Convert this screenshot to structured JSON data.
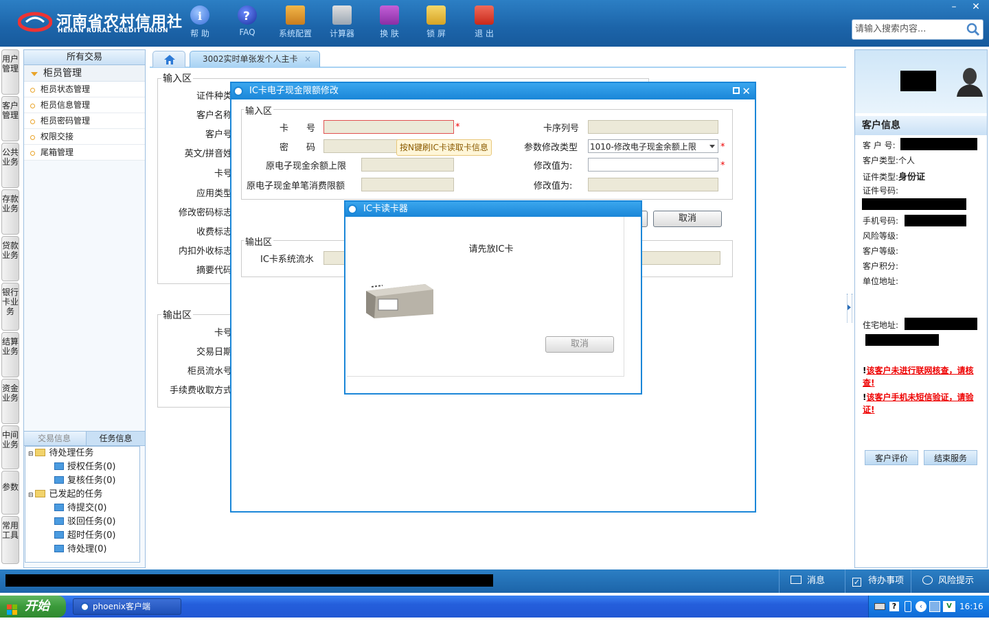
{
  "header": {
    "logo_cn": "河南省农村信用社",
    "logo_en": "HENAN RURAL CREDIT UNION",
    "toolbar": [
      {
        "label": "帮 助",
        "icon": "info-icon"
      },
      {
        "label": "FAQ",
        "icon": "question-icon"
      },
      {
        "label": "系统配置",
        "icon": "toolbox-icon"
      },
      {
        "label": "计算器",
        "icon": "calculator-icon"
      },
      {
        "label": "换 肤",
        "icon": "shirt-icon"
      },
      {
        "label": "锁 屏",
        "icon": "lock-icon"
      },
      {
        "label": "退 出",
        "icon": "power-icon"
      }
    ],
    "search_placeholder": "请输入搜索内容...",
    "minimize": "–",
    "close": "✕"
  },
  "vtabs": [
    "用户管理",
    "客户管理",
    "公共业务",
    "存款业务",
    "贷款业务",
    "银行卡业务",
    "结算业务",
    "资金业务",
    "中间业务",
    "参数",
    "常用工具"
  ],
  "leftpanel": {
    "title": "所有交易",
    "group": "柜员管理",
    "items": [
      "柜员状态管理",
      "柜员信息管理",
      "柜员密码管理",
      "权限交接",
      "尾箱管理"
    ],
    "tabs": [
      "交易信息",
      "任务信息"
    ],
    "tree": {
      "pending": "待处理任务",
      "auth": "授权任务(0)",
      "review": "复核任务(0)",
      "initiated": "已发起的任务",
      "to_submit": "待提交(0)",
      "rejected": "驳回任务(0)",
      "timeout": "超时任务(0)",
      "to_process": "待处理(0)"
    }
  },
  "content": {
    "tab_label": "3002实时单张发个人主卡",
    "tab_close": "×",
    "input_section": "输入区",
    "input_labels": [
      "证件种类",
      "客户名称",
      "客户号",
      "英文/拼音姓",
      "卡号",
      "应用类型",
      "修改密码标志",
      "收费标志",
      "内扣外收标志",
      "摘要代码"
    ],
    "output_section": "输出区",
    "output_labels": [
      "卡号",
      "交易日期",
      "柜员流水号",
      "手续费收取方式"
    ]
  },
  "dialog": {
    "title": "IC卡电子现金限额修改",
    "input_section": "输入区",
    "card_no_label": "卡　　号",
    "password_label": "密　　码",
    "tooltip": "按N键刷IC卡读取卡信息",
    "balance_limit_label": "原电子现金余额上限",
    "single_limit_label": "原电子现金单笔消费限额",
    "card_seq_label": "卡序列号",
    "param_type_label": "参数修改类型",
    "param_type_value": "1010-修改电子现金余额上限",
    "modify_value_label_1": "修改值为:",
    "modify_value_label_2": "修改值为:",
    "required": "*",
    "output_section": "输出区",
    "ic_serial_label": "IC卡系统流水",
    "cancel_button": "取消"
  },
  "reader": {
    "title": "IC卡读卡器",
    "message": "请先放IC卡",
    "cancel_button": "取消"
  },
  "right": {
    "title": "客户信息",
    "fields": [
      "客 户 号:",
      "客户类型:",
      "证件类型:",
      "证件号码:",
      "手机号码:",
      "风险等级:",
      "客户等级:",
      "客户积分:",
      "单位地址:",
      "住宅地址:"
    ],
    "customer_type": "个人",
    "id_type": "身份证",
    "warn1": "该客户未进行联网核查，请核查!",
    "warn2": "该客户手机未短信验证，请验证!",
    "warn_mark": "!",
    "btn_eval": "客户评价",
    "btn_end": "结束服务"
  },
  "statusbar": {
    "msg": "消息",
    "todo": "待办事项",
    "risk": "风险提示"
  },
  "taskbar": {
    "start": "开始",
    "app": "phoenix客户端",
    "time": "16:16"
  }
}
